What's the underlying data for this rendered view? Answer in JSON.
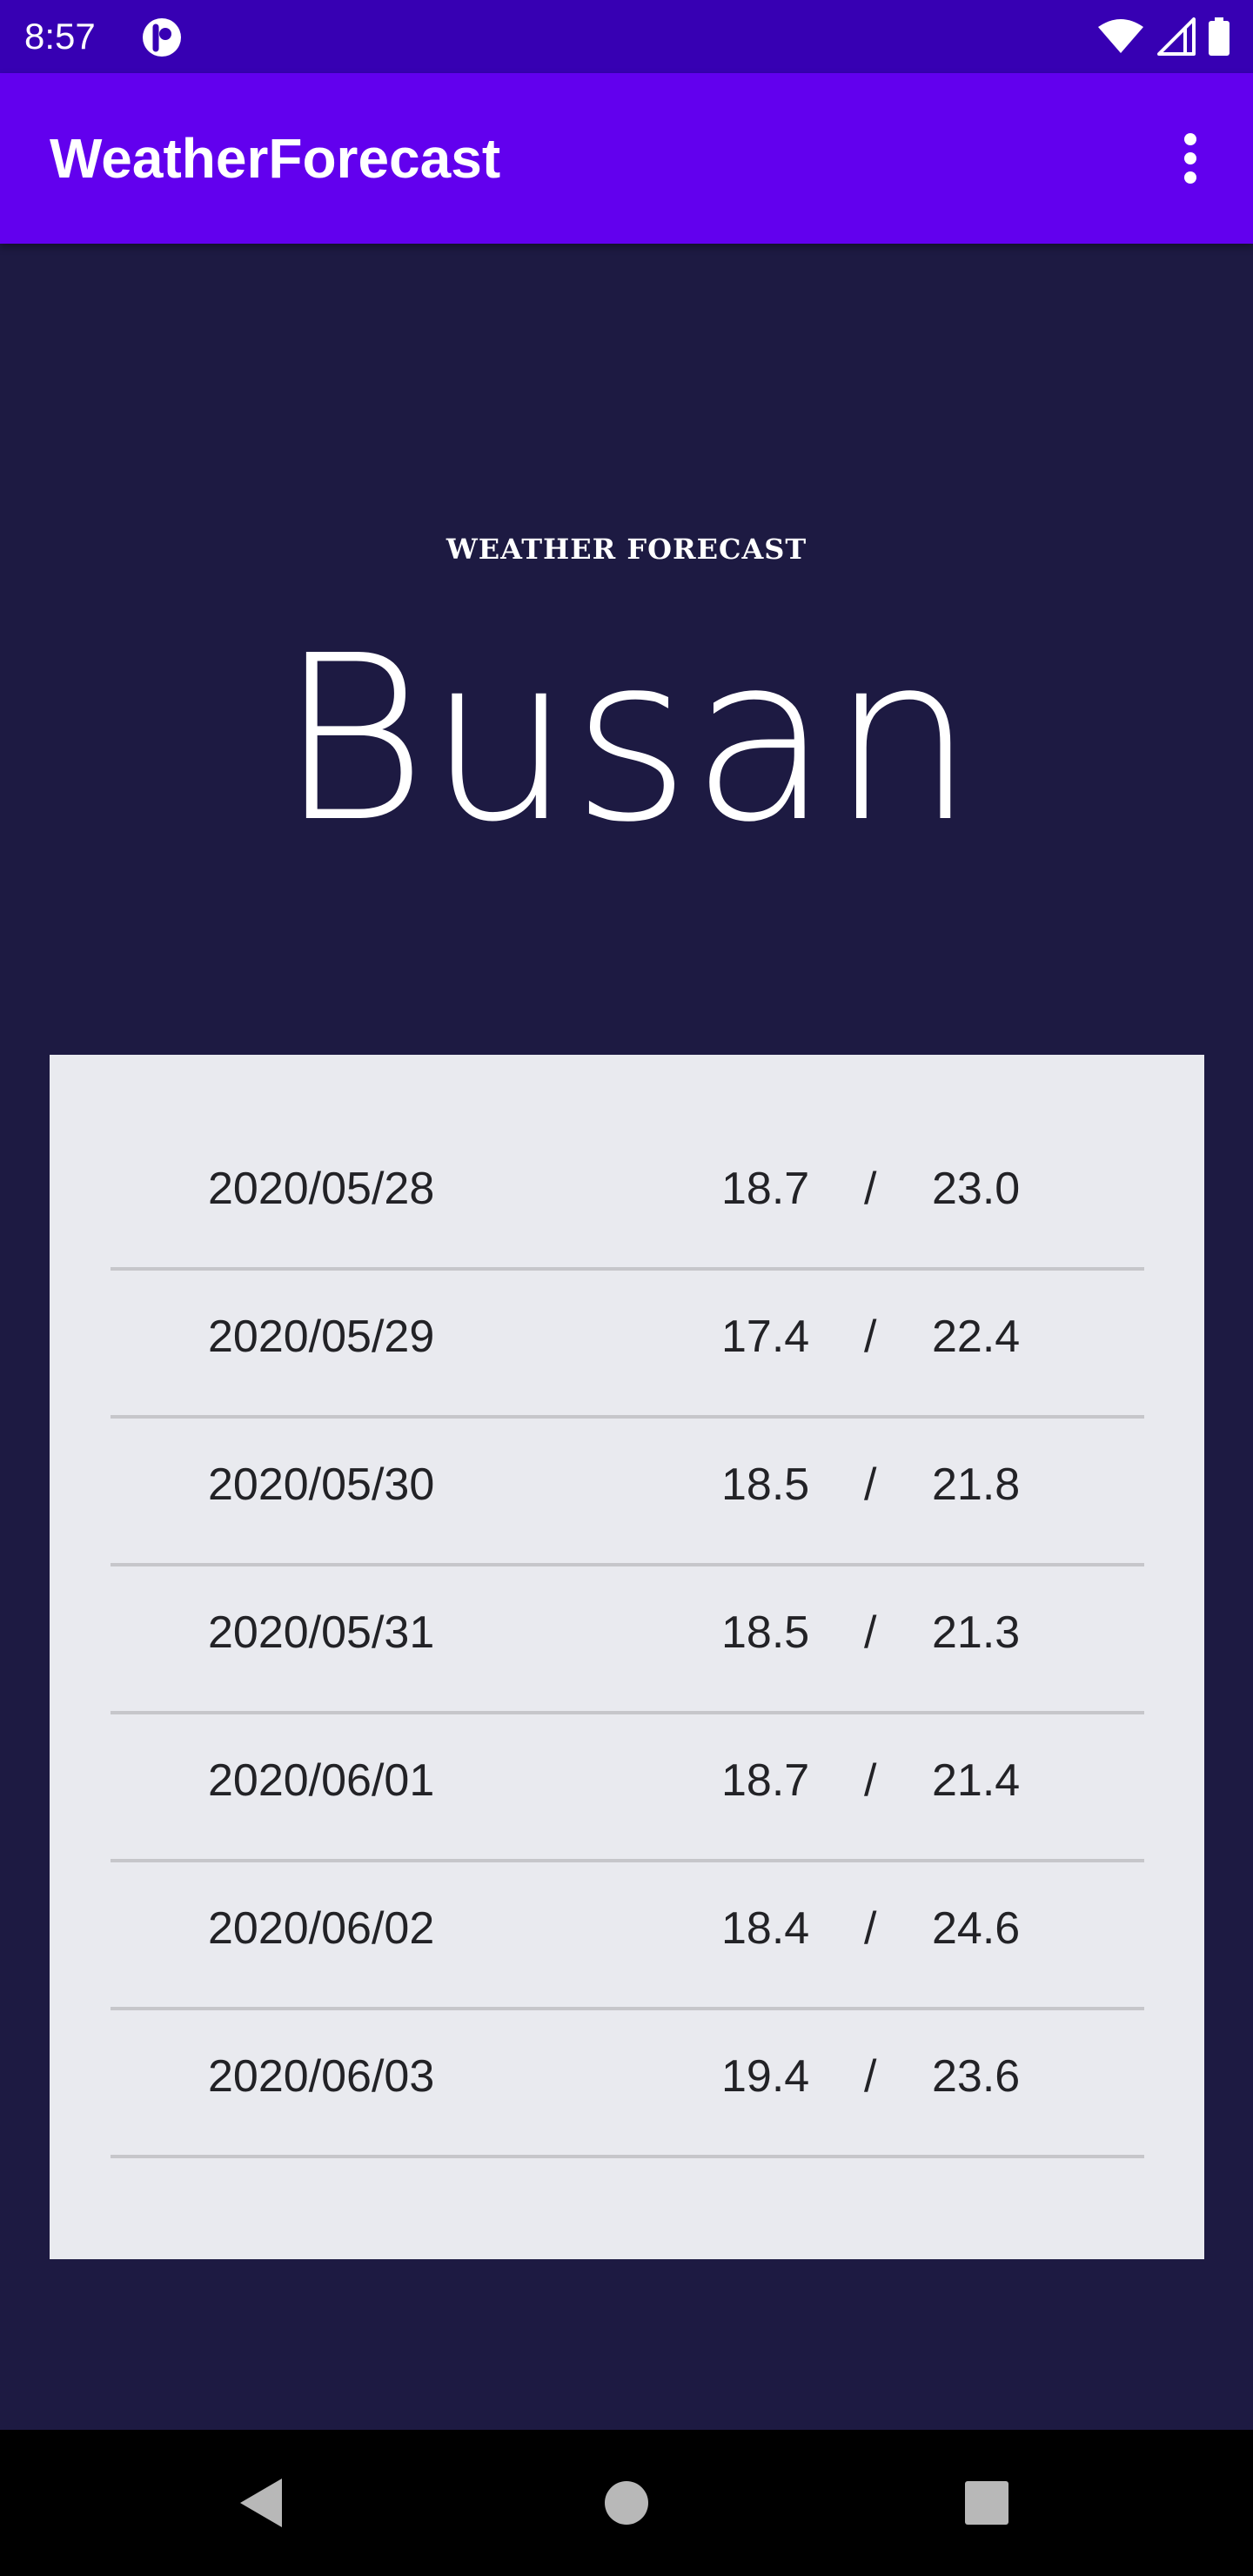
{
  "status_bar": {
    "time": "8:57",
    "app_icon": "app-notification-icon",
    "icons": [
      "wifi-icon",
      "cell-signal-icon",
      "battery-icon"
    ]
  },
  "app_bar": {
    "title": "WeatherForecast",
    "menu_icon": "more-vert-icon",
    "color": "#6200ee"
  },
  "header": {
    "subtitle": "WEATHER FORECAST",
    "city": "Busan"
  },
  "forecast": [
    {
      "date": "2020/05/28",
      "low": "18.7",
      "sep": "/",
      "high": "23.0"
    },
    {
      "date": "2020/05/29",
      "low": "17.4",
      "sep": "/",
      "high": "22.4"
    },
    {
      "date": "2020/05/30",
      "low": "18.5",
      "sep": "/",
      "high": "21.8"
    },
    {
      "date": "2020/05/31",
      "low": "18.5",
      "sep": "/",
      "high": "21.3"
    },
    {
      "date": "2020/06/01",
      "low": "18.7",
      "sep": "/",
      "high": "21.4"
    },
    {
      "date": "2020/06/02",
      "low": "18.4",
      "sep": "/",
      "high": "24.6"
    },
    {
      "date": "2020/06/03",
      "low": "19.4",
      "sep": "/",
      "high": "23.6"
    }
  ],
  "nav_bar": {
    "icons": [
      "back-icon",
      "home-icon",
      "recents-icon"
    ]
  },
  "colors": {
    "status_bar": "#3700b3",
    "background": "#1d1a42",
    "card": "#e9eaef"
  }
}
